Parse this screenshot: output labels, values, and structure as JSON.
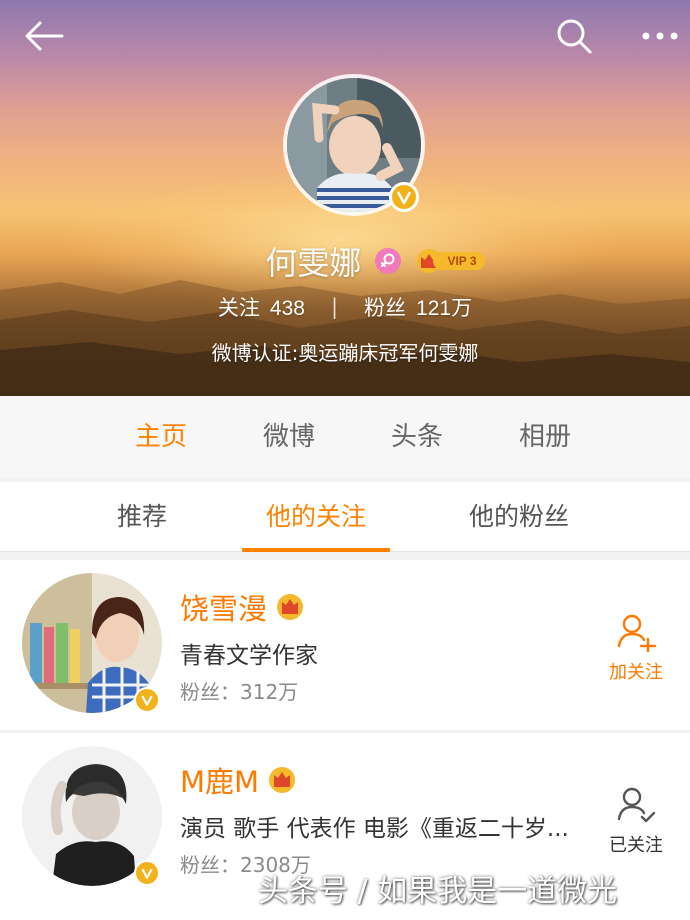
{
  "header": {
    "back_icon": "arrow-left-icon",
    "search_icon": "search-icon",
    "more_icon": "more-dots-icon"
  },
  "profile": {
    "name": "何雯娜",
    "gender_icon": "female-icon",
    "vip_label": "VIP 3",
    "stats": {
      "following_label": "关注",
      "following_value": "438",
      "separator": "|",
      "fans_label": "粉丝",
      "fans_value": "121万"
    },
    "verification": "微博认证:奥运蹦床冠军何雯娜"
  },
  "main_tabs": [
    {
      "label": "主页",
      "active": true
    },
    {
      "label": "微博",
      "active": false
    },
    {
      "label": "头条",
      "active": false
    },
    {
      "label": "相册",
      "active": false
    }
  ],
  "sub_tabs": [
    {
      "label": "推荐",
      "active": false
    },
    {
      "label": "他的关注",
      "active": true
    },
    {
      "label": "他的粉丝",
      "active": false
    }
  ],
  "users": [
    {
      "name": "饶雪漫",
      "description": "青春文学作家",
      "fans": "粉丝：312万",
      "action_label": "加关注",
      "action_icon": "add-user-icon"
    },
    {
      "name": "M鹿M",
      "description": "演员 歌手 代表作 电影《重返二十岁...",
      "fans": "粉丝：2308万",
      "action_label": "已关注",
      "action_icon": "followed-user-icon"
    }
  ],
  "watermark": "头条号 / 如果我是一道微光",
  "colors": {
    "accent": "#ff8200",
    "verified_badge": "#f3b21b",
    "gender_badge": "#f07ab9"
  }
}
